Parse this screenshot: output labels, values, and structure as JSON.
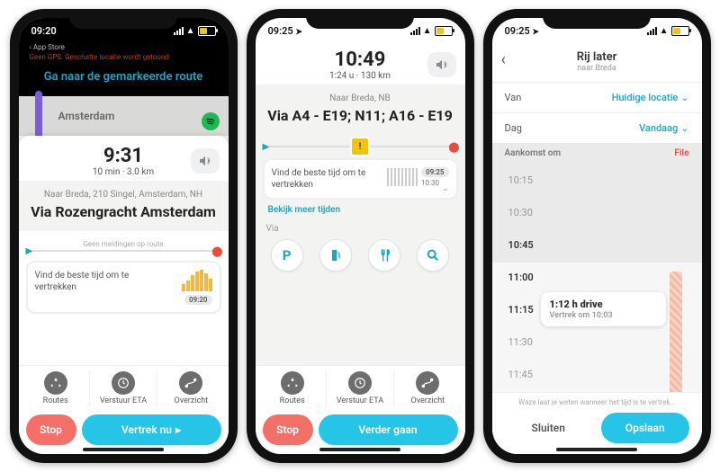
{
  "status": {
    "p1_time": "09:20",
    "p2_time": "09:25",
    "p3_time": "09:25"
  },
  "p1": {
    "appstore_back": "App Store",
    "gps_warn": "Geen GPS. Geschatte locatie wordt getoond",
    "banner": "Ga naar de gemarkeerde route",
    "map_city": "Amsterdam",
    "eta": "9:31",
    "eta_sub": "10 min · 3.0 km",
    "dest_sub": "Naar Breda, 210 Singel, Amsterdam, NH",
    "dest_main": "Via Rozengracht Amsterdam",
    "progress_label": "Geen meldingen op route",
    "depart_text": "Vind de beste tijd om te vertrekken",
    "depart_time": "09:20",
    "routes": "Routes",
    "send_eta": "Verstuur ETA",
    "overview": "Overzicht",
    "stop": "Stop",
    "go": "Vertrek nu"
  },
  "p2": {
    "eta": "10:49",
    "eta_sub": "1:24 u · 130 km",
    "dest_sub": "Naar Breda, NB",
    "dest_main": "Via A4 - E19; N11; A16 - E19",
    "depart_text": "Vind de beste tijd om te vertrekken",
    "depart_time1": "09:25",
    "depart_time2": "10:30",
    "more_times": "Bekijk meer tijden",
    "via": "Via",
    "routes": "Routes",
    "send_eta": "Verstuur ETA",
    "overview": "Overzicht",
    "stop": "Stop",
    "go": "Verder gaan"
  },
  "p3": {
    "title": "Rij later",
    "sub": "naar Breda",
    "from_label": "Van",
    "from_val": "Huidige locatie",
    "day_label": "Dag",
    "day_val": "Vandaag",
    "arrive_label": "Aankomst om",
    "file_label": "File",
    "times": [
      "10:15",
      "10:30",
      "10:45",
      "11:00",
      "11:15",
      "11:30",
      "11:45"
    ],
    "highlight_title": "1:12 h drive",
    "highlight_sub": "Vertrek om 10:03",
    "foot_text": "Waze laat je weten wanneer het tijd is te vertrek…",
    "close": "Sluiten",
    "save": "Opslaan"
  }
}
